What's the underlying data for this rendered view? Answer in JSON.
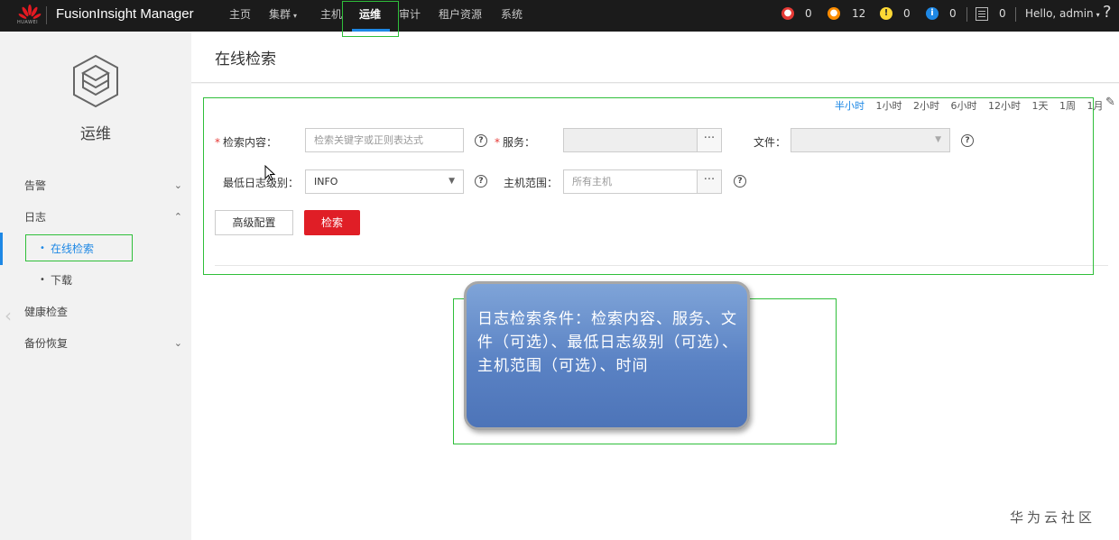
{
  "header": {
    "logo_text": "HUAWEI",
    "app_title": "FusionInsight Manager",
    "nav": [
      {
        "label": "主页",
        "caret": ""
      },
      {
        "label": "集群",
        "caret": "▾"
      },
      {
        "label": "主机",
        "caret": ""
      },
      {
        "label": "运维",
        "caret": ""
      },
      {
        "label": "审计",
        "caret": ""
      },
      {
        "label": "租户资源",
        "caret": ""
      },
      {
        "label": "系统",
        "caret": ""
      }
    ],
    "alarms": [
      {
        "icon": "critical-alarm-icon",
        "color": "#e53935",
        "count": "0"
      },
      {
        "icon": "major-alarm-icon",
        "color": "#fb8c00",
        "count": "12"
      },
      {
        "icon": "minor-alarm-icon",
        "color": "#fdd835",
        "count": "0"
      },
      {
        "icon": "info-alarm-icon",
        "color": "#1e88e5",
        "count": "0"
      }
    ],
    "tasks_count": "0",
    "user": "Hello, admin",
    "help": "?"
  },
  "sidebar": {
    "module_title": "运维",
    "items": [
      {
        "label": "告警",
        "chev": "⌄"
      },
      {
        "label": "日志",
        "chev": "⌃"
      },
      {
        "label": "健康检查",
        "chev": ""
      },
      {
        "label": "备份恢复",
        "chev": "⌄"
      }
    ],
    "sub_items": [
      {
        "label": "在线检索",
        "dot": "•"
      },
      {
        "label": "下载",
        "dot": "•"
      }
    ]
  },
  "main": {
    "page_title": "在线检索",
    "time_ranges": [
      "半小时",
      "1小时",
      "2小时",
      "6小时",
      "12小时",
      "1天",
      "1周",
      "1月"
    ],
    "form": {
      "content_label": "检索内容：",
      "content_placeholder": "检索关键字或正则表达式",
      "service_label": "服务：",
      "service_value": "",
      "file_label": "文件：",
      "file_value": "",
      "min_level_label": "最低日志级别：",
      "min_level_value": "INFO",
      "host_range_label": "主机范围：",
      "host_range_placeholder": "所有主机",
      "required_mark": "*",
      "dots": "···",
      "help": "?"
    },
    "buttons": {
      "advanced": "高级配置",
      "search": "检索"
    }
  },
  "overlay": {
    "callout_text": "日志检索条件：检索内容、服务、文件（可选）、最低日志级别（可选）、主机范围（可选）、时间",
    "watermark": "华为云社区"
  }
}
